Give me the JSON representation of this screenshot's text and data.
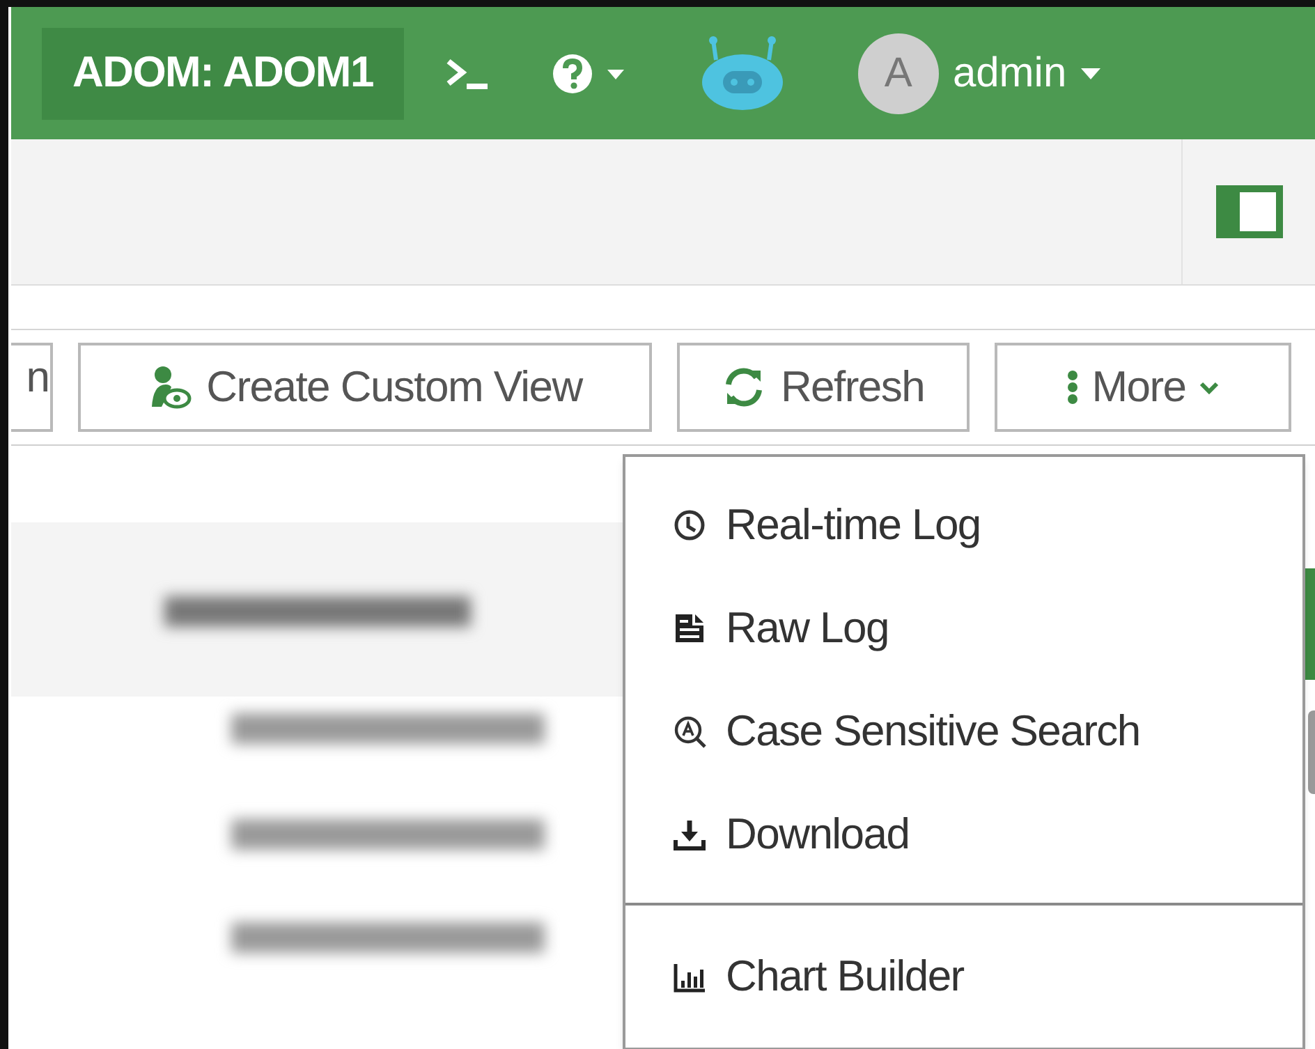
{
  "header": {
    "adom": "ADOM: ADOM1",
    "user_initial": "A",
    "user": "admin"
  },
  "toolbar": {
    "cut_button": "n",
    "buttons": [
      {
        "label": "Create Custom View",
        "kind": "custom-view"
      },
      {
        "label": "Refresh",
        "kind": "refresh"
      },
      {
        "label": "More",
        "kind": "more",
        "expanded": true
      }
    ]
  },
  "menu": {
    "sections": [
      [
        {
          "label": "Real-time Log",
          "kind": "clock"
        },
        {
          "label": "Raw Log",
          "kind": "raw"
        },
        {
          "label": "Case Sensitive Search",
          "kind": "case"
        },
        {
          "label": "Download",
          "kind": "download"
        }
      ],
      [
        {
          "label": "Chart Builder",
          "kind": "chart"
        }
      ]
    ]
  }
}
